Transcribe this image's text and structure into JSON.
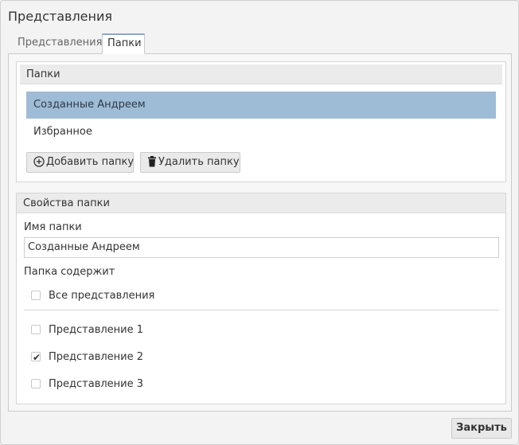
{
  "dialog": {
    "title": "Представления"
  },
  "tabs": [
    {
      "label": "Представления"
    },
    {
      "label": "Папки"
    }
  ],
  "folders": {
    "header": "Папки",
    "items": [
      {
        "label": "Созданные Андреем",
        "selected": true
      },
      {
        "label": "Избранное",
        "selected": false
      }
    ],
    "add_button": "Добавить папку",
    "delete_button": "Удалить папку"
  },
  "properties": {
    "header": "Свойства папки",
    "name_label": "Имя папки",
    "name_value": "Созданные Андреем",
    "contains_label": "Папка содержит",
    "all_label": "Все представления",
    "all_checked": false,
    "views": [
      {
        "label": "Представление 1",
        "checked": false
      },
      {
        "label": "Представление 2",
        "checked": true
      },
      {
        "label": "Представление 3",
        "checked": false
      }
    ]
  },
  "footer": {
    "close_label": "Закрыть"
  },
  "colors": {
    "selection": "#9fbcd6",
    "tab_accent": "#8aa8c8"
  },
  "icons": {
    "add": "plus-circle-icon",
    "delete": "trash-icon",
    "check": "check-icon"
  }
}
